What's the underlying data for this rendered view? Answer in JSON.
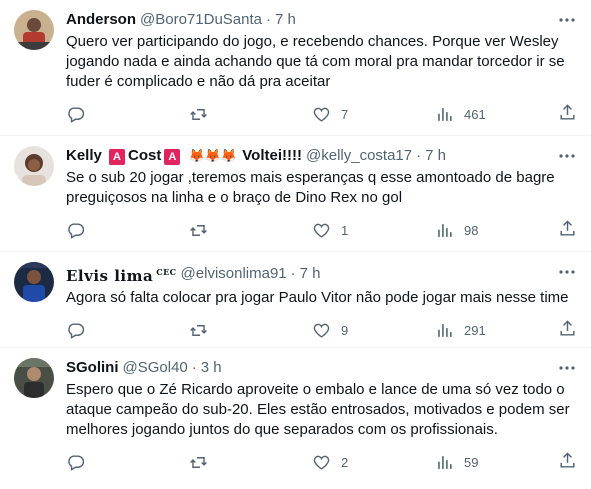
{
  "tweets": [
    {
      "name": "Anderson",
      "handle": "@Boro71DuSanta",
      "time": "7 h",
      "text": "Quero ver participando do jogo, e recebendo chances. Porque ver Wesley jogando nada e ainda achando que tá com moral pra mandar torcedor ir se fuder é complicado e não dá pra aceitar",
      "replies": "",
      "retweets": "",
      "likes": "7",
      "views": "461"
    },
    {
      "name_parts": [
        "Kelly",
        "A",
        "Cost",
        "A",
        "🦊🦊🦊",
        "Voltei!!!!"
      ],
      "handle": "@kelly_costa17",
      "time": "7 h",
      "text": "Se o sub 20 jogar ,teremos mais esperanças q esse amontoado de bagre preguiçosos na linha e  o braço de Dino Rex no gol",
      "replies": "",
      "retweets": "",
      "likes": "1",
      "views": "98"
    },
    {
      "name": "Elvis lima",
      "name_suffix": "CEC",
      "handle": "@elvisonlima91",
      "time": "7 h",
      "text": "Agora só falta colocar pra jogar Paulo Vitor não pode jogar mais nesse time",
      "replies": "",
      "retweets": "",
      "likes": "9",
      "views": "291"
    },
    {
      "name": "SGolini",
      "handle": "@SGol40",
      "time": "3 h",
      "text": "Espero que o Zé Ricardo aproveite o embalo e lance de uma só vez todo o ataque campeão do sub-20. Eles estão entrosados, motivados e podem ser melhores jogando juntos do que separados com os profissionais.",
      "replies": "",
      "retweets": "",
      "likes": "2",
      "views": "59"
    }
  ],
  "separator": "·",
  "colors": {
    "text": "#0f1419",
    "muted": "#536471",
    "border": "#eff3f4"
  }
}
